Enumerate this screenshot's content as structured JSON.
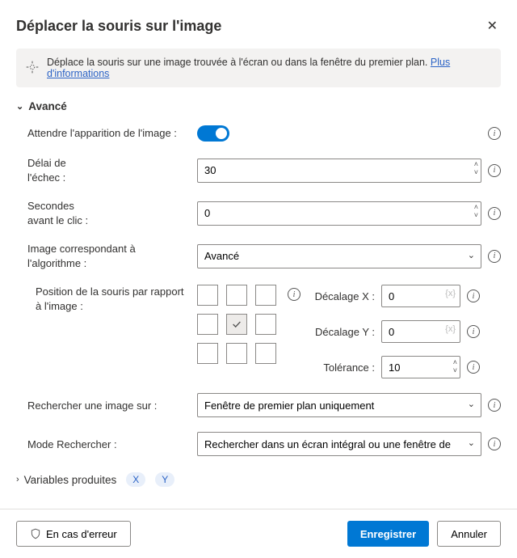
{
  "dialog": {
    "title": "Déplacer la souris sur l'image"
  },
  "banner": {
    "text": "Déplace la souris sur une image trouvée à l'écran ou dans la fenêtre du premier plan.",
    "link": "Plus d'informations"
  },
  "sections": {
    "advanced": "Avancé",
    "produced": "Variables produites"
  },
  "fields": {
    "wait_image": {
      "label": "Attendre l'apparition de l'image :",
      "on": true
    },
    "fail_delay": {
      "label": "Délai de\nl'échec :",
      "value": "30"
    },
    "seconds_before": {
      "label": "Secondes\navant le clic :",
      "value": "0"
    },
    "algorithm": {
      "label": "Image correspondant à l'algorithme :",
      "value": "Avancé"
    },
    "position": {
      "label": "Position de la souris par rapport à l'image :"
    },
    "offset_x": {
      "label": "Décalage X :",
      "value": "0"
    },
    "offset_y": {
      "label": "Décalage Y :",
      "value": "0"
    },
    "tolerance": {
      "label": "Tolérance :",
      "value": "10"
    },
    "search_on": {
      "label": "Rechercher une image sur :",
      "value": "Fenêtre de premier plan uniquement"
    },
    "search_mode": {
      "label": "Mode Rechercher :",
      "value": "Rechercher dans un écran intégral ou une fenêtre de"
    }
  },
  "produced_vars": {
    "x": "X",
    "y": "Y"
  },
  "footer": {
    "on_error": "En cas d'erreur",
    "save": "Enregistrer",
    "cancel": "Annuler"
  },
  "icons": {
    "fx": "{x}"
  }
}
